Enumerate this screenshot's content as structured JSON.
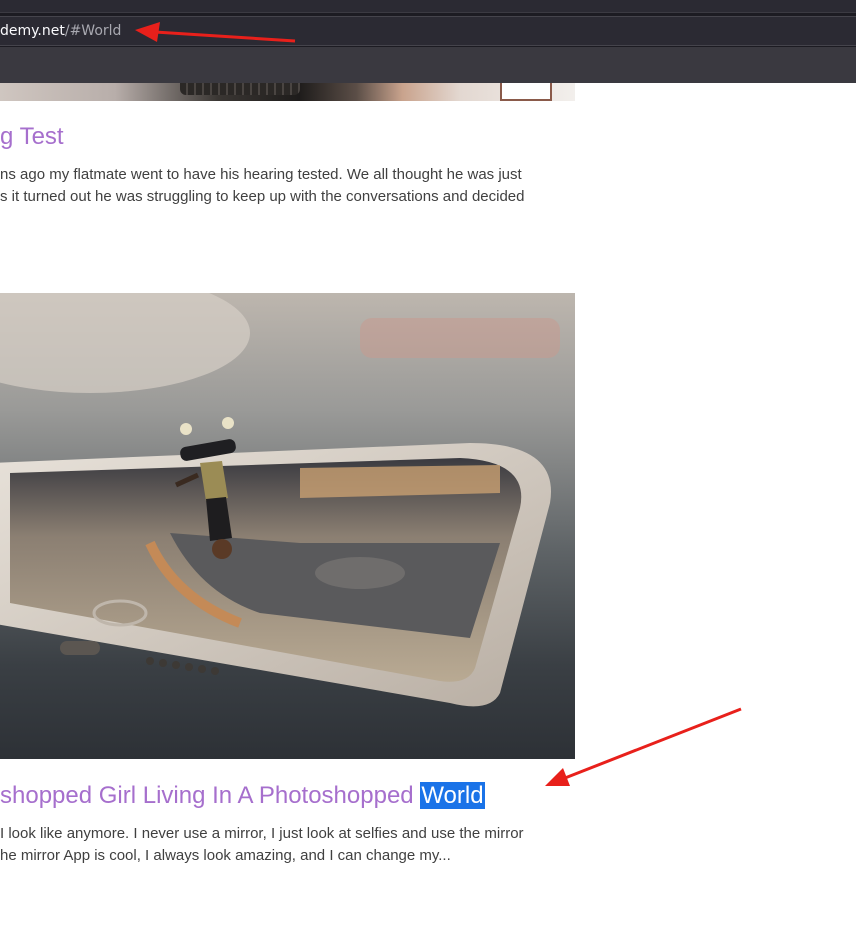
{
  "browser": {
    "url_host_visible": "demy.net",
    "url_hash": "/#World"
  },
  "posts": [
    {
      "title_visible": "g Test",
      "excerpt_lines": [
        "ns ago my flatmate went to have his hearing tested. We all thought he was just",
        "s it turned out he was struggling to keep up with the conversations and decided"
      ]
    },
    {
      "title_prefix": "shopped Girl Living In A Photoshopped ",
      "title_highlight": "World",
      "excerpt_lines": [
        " I look like anymore. I never use a mirror, I just look at selfies and use the mirror",
        "he mirror App is cool, I always look amazing, and I can change my..."
      ]
    }
  ],
  "colors": {
    "title_link": "#a66fcd",
    "excerpt_text": "#404040",
    "selection_highlight": "#1a73e8",
    "annotation_arrow": "#e8201b"
  },
  "icons": [
    "annotation-arrow-icon"
  ]
}
